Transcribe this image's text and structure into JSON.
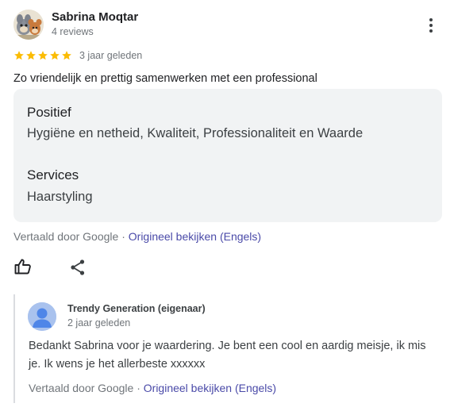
{
  "review": {
    "author": {
      "name": "Sabrina Moqtar",
      "meta": "4 reviews",
      "avatar_icon": "cartoon-avatar-icon"
    },
    "more_icon": "more-vertical-icon",
    "rating": 5,
    "rating_max": 5,
    "star_color": "#fbbc04",
    "time": "3 jaar geleden",
    "text": "Zo vriendelijk en prettig samenwerken met een professional",
    "attributes": [
      {
        "heading": "Positief",
        "value": "Hygiëne en netheid, Kwaliteit, Professionaliteit en Waarde"
      },
      {
        "heading": "Services",
        "value": "Haarstyling"
      }
    ],
    "translated_prefix": "Vertaald door Google · ",
    "translated_link": "Origineel bekijken (Engels)",
    "like_icon": "thumbs-up-icon",
    "share_icon": "share-icon"
  },
  "reply": {
    "owner_name": "Trendy Generation (eigenaar)",
    "time": "2 jaar geleden",
    "avatar_icon": "person-icon",
    "text": "Bedankt Sabrina voor je waardering. Je bent een cool en aardig meisje, ik mis je. Ik wens je het allerbeste xxxxxx",
    "translated_prefix": "Vertaald door Google · ",
    "translated_link": "Origineel bekijken (Engels)"
  },
  "colors": {
    "link": "#4a4aa8",
    "attribute_box": "#f1f3f4",
    "secondary_text": "#70757a"
  }
}
